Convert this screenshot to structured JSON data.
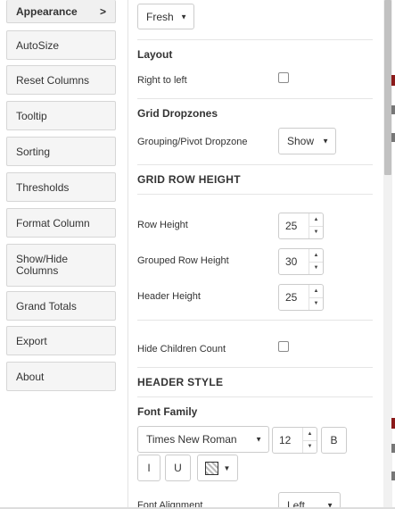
{
  "sidebar": {
    "items": [
      {
        "label": "Appearance",
        "chevron": ">"
      },
      {
        "label": "AutoSize"
      },
      {
        "label": "Reset Columns"
      },
      {
        "label": "Tooltip"
      },
      {
        "label": "Sorting"
      },
      {
        "label": "Thresholds"
      },
      {
        "label": "Format Column"
      },
      {
        "label": "Show/Hide Columns"
      },
      {
        "label": "Grand Totals"
      },
      {
        "label": "Export"
      },
      {
        "label": "About"
      }
    ]
  },
  "panel": {
    "theme_select": "Fresh",
    "layout": {
      "title": "Layout",
      "right_to_left": "Right to left"
    },
    "dropzones": {
      "title": "Grid Dropzones",
      "label": "Grouping/Pivot Dropzone",
      "value": "Show"
    },
    "row_height": {
      "title": "GRID ROW HEIGHT",
      "row_height_label": "Row Height",
      "row_height_value": "25",
      "grouped_label": "Grouped Row Height",
      "grouped_value": "30",
      "header_label": "Header Height",
      "header_value": "25"
    },
    "hide_children": "Hide Children Count",
    "header_style": {
      "title": "HEADER STYLE",
      "font_family_title": "Font Family",
      "font_family_value": "Times New Roman",
      "font_size_value": "12",
      "bold": "B",
      "italic": "I",
      "underline": "U",
      "font_alignment_label": "Font Alignment",
      "font_alignment_value": "Left"
    }
  },
  "icons": {
    "caret": "caret-down-icon",
    "up": "arrow-up-icon",
    "down": "arrow-down-icon",
    "color": "color-swatch-icon"
  },
  "colors": {
    "scroll_thumb": "#c1c1c1",
    "edge_accent": "#8b1a1a"
  }
}
